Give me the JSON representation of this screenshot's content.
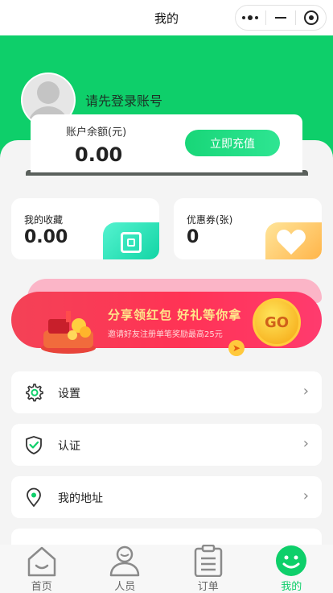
{
  "nav": {
    "title": "我的",
    "capsule_icons": [
      "more-dots-icon",
      "minimize-icon",
      "close-target-icon"
    ]
  },
  "profile": {
    "login_prompt": "请先登录账号"
  },
  "balance": {
    "label": "账户余额(元)",
    "value": "0.00",
    "recharge_label": "立即充值"
  },
  "stats": {
    "favorites": {
      "title": "我的收藏",
      "value": "0.00"
    },
    "coupons": {
      "title": "优惠券(张)",
      "value": "0"
    }
  },
  "banner": {
    "title": "分享领红包 好礼等你拿",
    "subtitle": "邀请好友注册单笔奖励最高25元",
    "go_label": "GO"
  },
  "menu": [
    {
      "label": "设置",
      "icon": "gear-icon"
    },
    {
      "label": "认证",
      "icon": "shield-check-icon"
    },
    {
      "label": "我的地址",
      "icon": "location-pin-icon"
    }
  ],
  "tabs": [
    {
      "label": "首页",
      "icon": "home-icon"
    },
    {
      "label": "人员",
      "icon": "person-icon"
    },
    {
      "label": "订单",
      "icon": "clipboard-icon"
    },
    {
      "label": "我的",
      "icon": "smile-icon",
      "active": true
    }
  ],
  "colors": {
    "brand_green": "#0ecf6a",
    "page_bg": "#f4f4f4",
    "banner_red": "#ff3355"
  }
}
